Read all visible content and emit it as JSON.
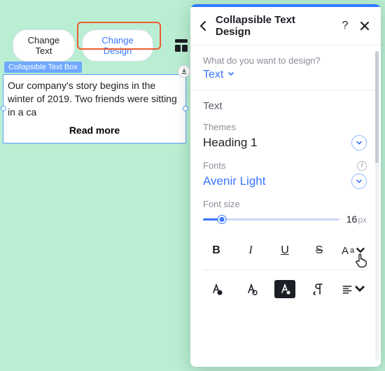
{
  "toolbar": {
    "change_text": "Change Text",
    "change_design": "Change Design"
  },
  "textbox": {
    "label": "Collapsible Text Box",
    "body": "Our company's story begins in the winter of 2019. Two friends were sitting in a ca",
    "read_more": "Read more"
  },
  "panel": {
    "title": "Collapsible Text Design",
    "q_label": "What do you want to design?",
    "q_value": "Text",
    "section_text": "Text",
    "themes_label": "Themes",
    "themes_value": "Heading 1",
    "fonts_label": "Fonts",
    "fonts_value": "Avenir Light",
    "fontsize_label": "Font size",
    "fontsize_value": "16",
    "fontsize_unit": "px",
    "bold": "B",
    "italic": "I",
    "underline": "U",
    "strike": "S",
    "case_big": "A",
    "case_small": "a"
  }
}
